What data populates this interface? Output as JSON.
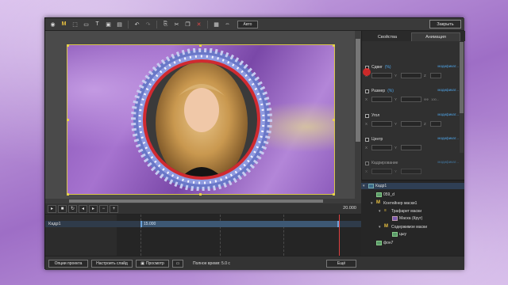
{
  "toolbar": {
    "m_label": "M",
    "text_label": "T",
    "select_value": "Авто"
  },
  "header": {
    "close_label": "Закрыть"
  },
  "right_panel": {
    "tabs": [
      {
        "label": "Свойства"
      },
      {
        "label": "Анимация"
      }
    ],
    "sections": [
      {
        "title": "Сдвиг",
        "unit": "(%)",
        "modifier": "модификат...",
        "fields": [
          "X",
          "Y"
        ],
        "extra_label": "Z"
      },
      {
        "title": "Размер",
        "unit": "(%)",
        "modifier": "модификат...",
        "fields": [
          "X",
          "Y"
        ],
        "extra_label": "ФФ",
        "extra_value": "100..."
      },
      {
        "title": "Угол",
        "unit": "",
        "modifier": "модификат...",
        "fields": [
          "X",
          "Y"
        ],
        "extra_label": "Z"
      },
      {
        "title": "Центр",
        "unit": "",
        "modifier": "модификат...",
        "fields": [
          "X",
          "Y"
        ],
        "extra_label": ""
      },
      {
        "title": "Кадрирование",
        "unit": "",
        "modifier": "модификат...",
        "fields": [
          "X",
          "Y"
        ],
        "extra_label": ""
      }
    ]
  },
  "tree": {
    "items": [
      {
        "label": "Кадр1"
      },
      {
        "label": "059_d"
      },
      {
        "label": "Контейнер маски1"
      },
      {
        "label": "Трафарет маски"
      },
      {
        "label": "Маска (Круг)"
      },
      {
        "label": "Содержимое маски"
      },
      {
        "label": "цыу"
      },
      {
        "label": "фон7"
      }
    ]
  },
  "timeline": {
    "end_time": "20.000",
    "track_label": "Кадр1",
    "clip_time": "15.000"
  },
  "bottom_bar": {
    "project_options": "Опции проекта",
    "slide_settings": "Настроить слайд",
    "preview": "Просмотр",
    "total_time": "Полное время: 5.0 с",
    "more": "Ещё"
  }
}
